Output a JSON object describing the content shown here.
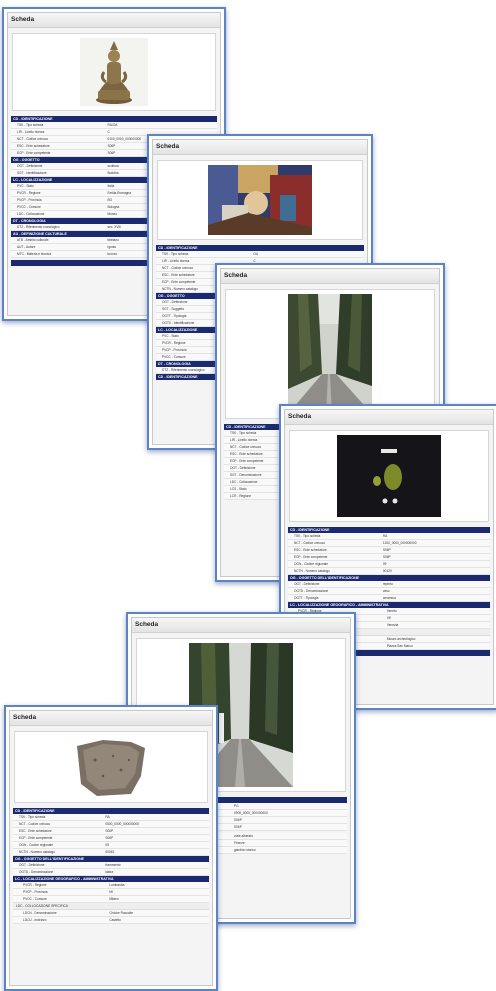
{
  "cards": [
    {
      "title": "Scheda",
      "image": "buddha-statue",
      "sections": [
        {
          "label": "CD - IDENTIFICAZIONE",
          "rows": [
            [
              "TSK - Tipo scheda",
              "RA/OA"
            ],
            [
              "LIR - Livello ricerca",
              "C"
            ],
            [
              "NCT - Codice univoco",
              "0100_0000_000000000"
            ],
            [
              "ESC - Ente schedatore",
              "S06P"
            ],
            [
              "ECP - Ente competente",
              "S06P"
            ]
          ]
        },
        {
          "label": "OG - OGGETTO",
          "rows": [
            [
              "OGT - Definizione",
              "scultura"
            ],
            [
              "SGT - Identificazione",
              "Buddha"
            ]
          ]
        },
        {
          "label": "LC - LOCALIZZAZIONE",
          "rows": [
            [
              "PVC - Stato",
              "Italia"
            ],
            [
              "PVCR - Regione",
              "Emilia-Romagna"
            ],
            [
              "PVCP - Provincia",
              "BO"
            ],
            [
              "PVCC - Comune",
              "Bologna"
            ],
            [
              "LDC - Collocazione",
              "Museo"
            ]
          ]
        },
        {
          "label": "DT - CRONOLOGIA",
          "rows": [
            [
              "DTZ - Riferimento cronologico",
              "sec. XVIII"
            ]
          ]
        },
        {
          "label": "AU - DEFINIZIONE CULTURALE",
          "rows": [
            [
              "ATB - Ambito culturale",
              "tibetano"
            ],
            [
              "AUT - Autore",
              "ignoto"
            ],
            [
              "MTC - Materia e tecnica",
              "bronzo"
            ]
          ]
        }
      ]
    },
    {
      "title": "Scheda",
      "image": "painting",
      "sections": [
        {
          "label": "CD - IDENTIFICAZIONE",
          "rows": [
            [
              "TSK - Tipo scheda",
              "OA"
            ],
            [
              "LIR - Livello ricerca",
              "C"
            ],
            [
              "NCT - Codice univoco",
              "0800_0000_000000000"
            ],
            [
              "ESC - Ente schedatore",
              "S06P"
            ],
            [
              "ECP - Ente competente",
              "S06P"
            ],
            [
              "NCTN - Numero catalogo",
              "000000"
            ]
          ]
        },
        {
          "label": "OG - OGGETTO",
          "rows": [
            [
              "OGT - Definizione",
              "dipinto"
            ],
            [
              "SGT - Soggetto",
              "scena"
            ],
            [
              "OGTT - Tipologia",
              "tela"
            ],
            [
              "OGTV - Identificazione",
              "opera isolata"
            ]
          ]
        },
        {
          "label": "LC - LOCALIZZAZIONE",
          "rows": [
            [
              "PVC - Stato",
              "Italia"
            ],
            [
              "PVCR - Regione",
              "Toscana"
            ],
            [
              "PVCP - Provincia",
              "FI"
            ],
            [
              "PVCC - Comune",
              "Firenze"
            ]
          ]
        },
        {
          "label": "DT - CRONOLOGIA",
          "rows": [
            [
              "DTZ - Riferimento cronologico",
              "sec. XVII"
            ]
          ]
        },
        {
          "label": "CD - IDENTIFICAZIONE",
          "rows": []
        }
      ]
    },
    {
      "title": "Scheda",
      "image": "cypress-road",
      "sections": [
        {
          "label": "CD - IDENTIFICAZIONE",
          "rows": [
            [
              "TSK - Tipo scheda",
              "PG"
            ],
            [
              "LIR - Livello ricerca",
              "P"
            ],
            [
              "NCT - Codice univoco",
              "0900_0000_000000000"
            ],
            [
              "ESC - Ente schedatore",
              "S06P"
            ],
            [
              "ECP - Ente competente",
              "S06P"
            ],
            [
              "OGT - Definizione",
              "viale"
            ],
            [
              "SGT - Denominazione",
              "viale dei cipressi"
            ],
            [
              "LDC - Collocazione",
              "Bolgheri"
            ],
            [
              "LCS - Stato",
              "Italia"
            ],
            [
              "LCR - Regione",
              "Toscana"
            ]
          ]
        }
      ]
    },
    {
      "title": "Scheda",
      "image": "archaeological-find",
      "sections": [
        {
          "label": "CD - IDENTIFICAZIONE",
          "rows": [
            [
              "TSK - Tipo scheda",
              "RA"
            ],
            [
              "NCT - Codice univoco",
              "1200_0000_000000000"
            ],
            [
              "ESC - Ente schedatore",
              "S06P"
            ],
            [
              "ECP - Ente competente",
              "S06P"
            ],
            [
              "OGN - Codice regionale",
              "09"
            ],
            [
              "NCTN - Numero catalogo",
              "00123"
            ]
          ]
        },
        {
          "label": "OG - OGGETTO DELL'IDENTIFICAZIONE",
          "rows": [
            [
              "OGT - Definizione",
              "reperto"
            ],
            [
              "OGTD - Denominazione",
              "vaso"
            ],
            [
              "OGTT - Tipologia",
              "ceramica"
            ]
          ]
        },
        {
          "label": "LC - LOCALIZZAZIONE GEOGRAFICO - AMMINISTRATIVA",
          "rows": [
            [
              "PVCR - Regione",
              "Veneto"
            ],
            [
              "PVCP - Provincia",
              "VE"
            ],
            [
              "PVCC - Comune",
              "Venezia"
            ]
          ]
        },
        {
          "label": "LDC - COLLOCAZIONE SPECIFICA",
          "rows": [
            [
              "LDCN - Denominazione",
              "Museo archeologico"
            ],
            [
              "LDCU - Indirizzo",
              "Piazza San Marco"
            ]
          ]
        },
        {
          "label": "DT - CRONOLOGIA",
          "rows": []
        }
      ]
    },
    {
      "title": "Scheda",
      "image": "tree-lined-road",
      "sections": [
        {
          "label": "CD - IDENTIFICAZIONE",
          "rows": [
            [
              "TSK - Tipo scheda",
              "PG"
            ],
            [
              "NCT - Codice univoco",
              "0900_0000_000000000"
            ],
            [
              "ESC - Ente schedatore",
              "S06P"
            ],
            [
              "ECP - Ente competente",
              "S06P"
            ],
            [
              "SGT - Denominazione",
              "viale alberato"
            ],
            [
              "PVCC - Comune",
              "Firenze"
            ],
            [
              "LDC - Collocazione",
              "giardino storico"
            ]
          ]
        }
      ]
    },
    {
      "title": "Scheda",
      "image": "stone-fragment",
      "sections": [
        {
          "label": "CD - IDENTIFICAZIONE",
          "rows": [
            [
              "TSK - Tipo scheda",
              "RA"
            ],
            [
              "NCT - Codice univoco",
              "0500_0000_000000000"
            ],
            [
              "ESC - Ente schedatore",
              "S06P"
            ],
            [
              "ECP - Ente competente",
              "S06P"
            ],
            [
              "OGN - Codice regionale",
              "05"
            ],
            [
              "NCTN - Numero catalogo",
              "00045"
            ]
          ]
        },
        {
          "label": "OG - OGGETTO DELL'IDENTIFICAZIONE",
          "rows": [
            [
              "OGT - Definizione",
              "frammento"
            ],
            [
              "OGTD - Denominazione",
              "lastra"
            ]
          ]
        },
        {
          "label": "LC - LOCALIZZAZIONE GEOGRAFICO - AMMINISTRATIVA",
          "rows": [
            [
              "PVCR - Regione",
              "Lombardia"
            ],
            [
              "PVCP - Provincia",
              "MI"
            ],
            [
              "PVCC - Comune",
              "Milano"
            ]
          ]
        },
        {
          "label": "LDC - COLLOCAZIONE SPECIFICA",
          "rows": [
            [
              "LDCN - Denominazione",
              "Civiche Raccolte"
            ],
            [
              "LDCU - Indirizzo",
              "Castello"
            ]
          ]
        }
      ]
    }
  ]
}
